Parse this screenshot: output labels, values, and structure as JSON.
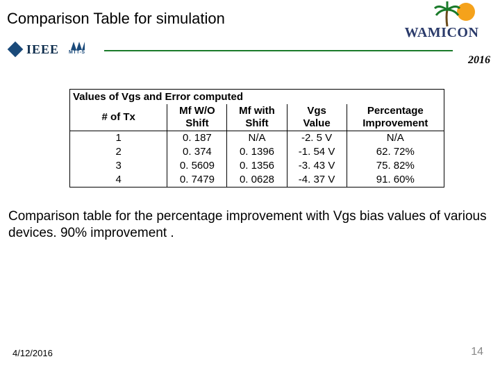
{
  "title": "Comparison Table for simulation",
  "year": "2016",
  "logos": {
    "wamicon": "WAMICON",
    "ieee": "IEEE",
    "mtts": "MTT-S"
  },
  "table": {
    "caption": "Values of Vgs  and Error computed",
    "headers": {
      "c0": "# of Tx",
      "c1a": "Mf W/O",
      "c1b": "Shift",
      "c2a": "Mf with",
      "c2b": "Shift",
      "c3a": "Vgs",
      "c3b": "Value",
      "c4a": "Percentage",
      "c4b": "Improvement"
    },
    "rows": [
      {
        "tx": "1",
        "mf_wo": "0. 187",
        "mf_with": "N/A",
        "vgs": "-2. 5 V",
        "pct": "N/A"
      },
      {
        "tx": "2",
        "mf_wo": "0. 374",
        "mf_with": "0. 1396",
        "vgs": "-1. 54 V",
        "pct": "62. 72%"
      },
      {
        "tx": "3",
        "mf_wo": "0. 5609",
        "mf_with": "0. 1356",
        "vgs": "-3. 43 V",
        "pct": "75. 82%"
      },
      {
        "tx": "4",
        "mf_wo": "0. 7479",
        "mf_with": "0. 0628",
        "vgs": "-4. 37 V",
        "pct": "91. 60%"
      }
    ]
  },
  "body_text": "Comparison table for the percentage improvement with Vgs bias values of various devices. 90% improvement .",
  "footer": {
    "date": "4/12/2016",
    "page": "14"
  },
  "chart_data": {
    "type": "table",
    "title": "Values of Vgs and Error computed",
    "columns": [
      "# of Tx",
      "Mf W/O Shift",
      "Mf with Shift",
      "Vgs Value",
      "Percentage Improvement"
    ],
    "rows": [
      [
        1,
        0.187,
        null,
        -2.5,
        null
      ],
      [
        2,
        0.374,
        0.1396,
        -1.54,
        62.72
      ],
      [
        3,
        0.5609,
        0.1356,
        -3.43,
        75.82
      ],
      [
        4,
        0.7479,
        0.0628,
        -4.37,
        91.6
      ]
    ]
  }
}
